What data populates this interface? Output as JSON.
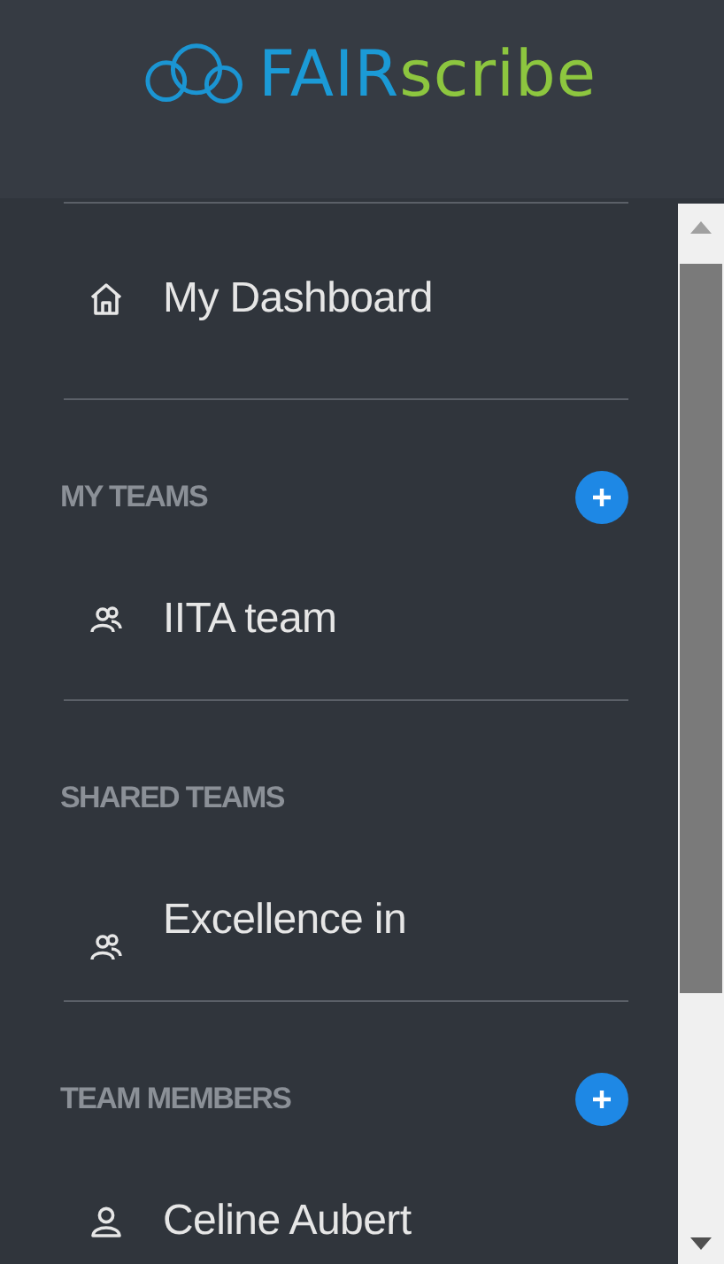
{
  "logo": {
    "text_primary": "FAIR",
    "text_secondary": "scribe"
  },
  "nav": [
    {
      "label": "My Dashboard",
      "kind": "home"
    }
  ],
  "sections": [
    {
      "title": "MY TEAMS",
      "add_button": true,
      "items": [
        {
          "label": "IITA team",
          "kind": "team",
          "cut_off": false
        }
      ]
    },
    {
      "title": "SHARED TEAMS",
      "add_button": false,
      "items": [
        {
          "label": "Excellence in",
          "kind": "team",
          "cut_off": true
        }
      ]
    },
    {
      "title": "TEAM MEMBERS",
      "add_button": true,
      "items": [
        {
          "label": "Celine Aubert",
          "kind": "person",
          "cut_off": false
        }
      ]
    }
  ]
}
